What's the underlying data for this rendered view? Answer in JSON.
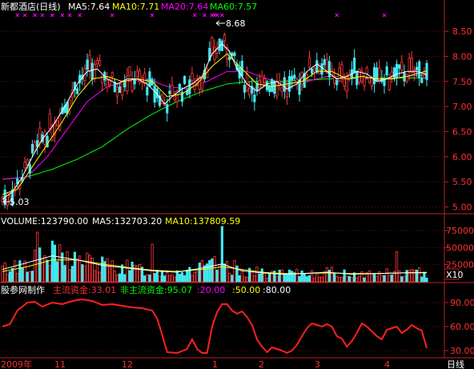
{
  "price_header": {
    "name": "新都酒店(日线)",
    "ma5": "MA5:7.64",
    "ma10": "MA10:7.71",
    "ma20": "MA20:7.64",
    "ma60": "MA60:7.57"
  },
  "price_annotations": {
    "high": "8.68",
    "low": "5.03"
  },
  "volume_header": {
    "volume": "VOLUME:123790.00",
    "ma5": "MA5:132703.20",
    "ma10": "MA10:137809.59"
  },
  "volume_unit": "X10",
  "indicator_header": {
    "title": "股参网制作",
    "main_fund": "主流资金:33.01",
    "non_main_fund": "非主流资金:95.07",
    "l20": ":20.00",
    "l50": ":50.00",
    "l80": ":80.00"
  },
  "x_axis": {
    "labels": [
      "2009年",
      "11",
      "12",
      "1",
      "2",
      "3",
      "4"
    ],
    "corner": "日线"
  },
  "colors": {
    "up": "#ff3b3b",
    "down": "#40e8f0",
    "ma5": "#ffffff",
    "ma10": "#ffff00",
    "ma20": "#ff00ff",
    "ma60": "#00ff00",
    "axis": "#c02020",
    "indicator": "#ff2020"
  },
  "chart_data": [
    {
      "type": "candlestick",
      "title": "新都酒店(日线)",
      "y_ticks": [
        5.0,
        5.5,
        6.0,
        6.5,
        7.0,
        7.5,
        8.0,
        8.5
      ],
      "ylim": [
        4.88,
        8.82
      ],
      "annotations": [
        {
          "label": "8.68",
          "value": 8.68
        },
        {
          "label": "5.03",
          "value": 5.03
        }
      ],
      "series": [
        {
          "name": "MA5",
          "anchors": [
            [
              0,
              5.15
            ],
            [
              4,
              5.3
            ],
            [
              8,
              5.6
            ],
            [
              12,
              6.0
            ],
            [
              16,
              6.35
            ],
            [
              20,
              6.6
            ],
            [
              25,
              7.0
            ],
            [
              30,
              7.45
            ],
            [
              34,
              7.7
            ],
            [
              38,
              7.75
            ],
            [
              42,
              7.55
            ],
            [
              46,
              7.45
            ],
            [
              50,
              7.55
            ],
            [
              54,
              7.55
            ],
            [
              58,
              7.45
            ],
            [
              62,
              7.25
            ],
            [
              65,
              7.05
            ],
            [
              68,
              7.2
            ],
            [
              72,
              7.35
            ],
            [
              76,
              7.45
            ],
            [
              80,
              7.6
            ],
            [
              84,
              8.05
            ],
            [
              88,
              8.25
            ],
            [
              91,
              8.1
            ],
            [
              94,
              7.75
            ],
            [
              98,
              7.45
            ],
            [
              102,
              7.3
            ],
            [
              106,
              7.45
            ],
            [
              110,
              7.5
            ],
            [
              114,
              7.35
            ],
            [
              118,
              7.45
            ],
            [
              122,
              7.7
            ],
            [
              126,
              7.85
            ],
            [
              130,
              7.7
            ],
            [
              134,
              7.55
            ],
            [
              138,
              7.6
            ],
            [
              142,
              7.7
            ],
            [
              146,
              7.65
            ],
            [
              150,
              7.5
            ],
            [
              154,
              7.55
            ],
            [
              158,
              7.65
            ],
            [
              162,
              7.7
            ],
            [
              166,
              7.7
            ],
            [
              170,
              7.64
            ]
          ]
        },
        {
          "name": "MA10",
          "anchors": [
            [
              0,
              5.25
            ],
            [
              6,
              5.35
            ],
            [
              12,
              5.8
            ],
            [
              18,
              6.25
            ],
            [
              24,
              6.7
            ],
            [
              30,
              7.2
            ],
            [
              36,
              7.55
            ],
            [
              42,
              7.6
            ],
            [
              48,
              7.5
            ],
            [
              54,
              7.55
            ],
            [
              60,
              7.5
            ],
            [
              66,
              7.2
            ],
            [
              72,
              7.25
            ],
            [
              78,
              7.45
            ],
            [
              84,
              7.8
            ],
            [
              90,
              8.05
            ],
            [
              96,
              7.75
            ],
            [
              102,
              7.45
            ],
            [
              108,
              7.4
            ],
            [
              114,
              7.45
            ],
            [
              120,
              7.5
            ],
            [
              126,
              7.7
            ],
            [
              132,
              7.7
            ],
            [
              138,
              7.55
            ],
            [
              144,
              7.6
            ],
            [
              150,
              7.55
            ],
            [
              156,
              7.55
            ],
            [
              162,
              7.6
            ],
            [
              170,
              7.71
            ]
          ]
        },
        {
          "name": "MA20",
          "anchors": [
            [
              0,
              5.55
            ],
            [
              10,
              5.6
            ],
            [
              18,
              6.0
            ],
            [
              26,
              6.55
            ],
            [
              34,
              7.1
            ],
            [
              42,
              7.4
            ],
            [
              50,
              7.5
            ],
            [
              58,
              7.55
            ],
            [
              66,
              7.4
            ],
            [
              74,
              7.35
            ],
            [
              82,
              7.5
            ],
            [
              90,
              7.7
            ],
            [
              98,
              7.7
            ],
            [
              106,
              7.55
            ],
            [
              114,
              7.45
            ],
            [
              122,
              7.5
            ],
            [
              130,
              7.6
            ],
            [
              138,
              7.6
            ],
            [
              146,
              7.55
            ],
            [
              154,
              7.55
            ],
            [
              162,
              7.6
            ],
            [
              170,
              7.64
            ]
          ]
        },
        {
          "name": "MA60",
          "anchors": [
            [
              0,
              5.55
            ],
            [
              10,
              5.6
            ],
            [
              20,
              5.75
            ],
            [
              30,
              5.95
            ],
            [
              40,
              6.2
            ],
            [
              50,
              6.55
            ],
            [
              60,
              6.85
            ],
            [
              70,
              7.1
            ],
            [
              80,
              7.3
            ],
            [
              90,
              7.45
            ],
            [
              100,
              7.5
            ],
            [
              110,
              7.5
            ],
            [
              120,
              7.52
            ],
            [
              130,
              7.55
            ],
            [
              140,
              7.56
            ],
            [
              150,
              7.57
            ],
            [
              160,
              7.57
            ],
            [
              170,
              7.57
            ]
          ]
        }
      ]
    },
    {
      "type": "bar",
      "title": "VOLUME",
      "y_ticks": [
        25000,
        50000,
        75000
      ],
      "ylim": [
        0,
        82000
      ],
      "unit": "X10",
      "series": [
        {
          "name": "MA5",
          "anchors": [
            [
              0,
              18000
            ],
            [
              10,
              28000
            ],
            [
              20,
              38000
            ],
            [
              30,
              32000
            ],
            [
              40,
              24000
            ],
            [
              50,
              20000
            ],
            [
              60,
              16000
            ],
            [
              70,
              14000
            ],
            [
              80,
              20000
            ],
            [
              88,
              26000
            ],
            [
              96,
              16000
            ],
            [
              104,
              13000
            ],
            [
              112,
              11000
            ],
            [
              120,
              12000
            ],
            [
              130,
              14000
            ],
            [
              140,
              11000
            ],
            [
              150,
              12000
            ],
            [
              160,
              13000
            ],
            [
              170,
              13270
            ]
          ]
        },
        {
          "name": "MA10",
          "anchors": [
            [
              0,
              15000
            ],
            [
              10,
              22000
            ],
            [
              20,
              32000
            ],
            [
              30,
              32000
            ],
            [
              40,
              26000
            ],
            [
              50,
              21000
            ],
            [
              60,
              17000
            ],
            [
              70,
              15000
            ],
            [
              80,
              18000
            ],
            [
              88,
              22000
            ],
            [
              96,
              18000
            ],
            [
              104,
              14000
            ],
            [
              112,
              12000
            ],
            [
              120,
              12000
            ],
            [
              130,
              13000
            ],
            [
              140,
              12000
            ],
            [
              150,
              12000
            ],
            [
              160,
              13000
            ],
            [
              170,
              13781
            ]
          ]
        }
      ]
    },
    {
      "type": "line",
      "title": "股参网制作",
      "y_ticks": [
        30.0,
        60.0,
        90.0
      ],
      "ylim": [
        22,
        100
      ],
      "reference_lines": [
        20,
        50,
        80
      ],
      "series": [
        {
          "name": "主流资金",
          "anchors": [
            [
              0,
              60
            ],
            [
              3,
              63
            ],
            [
              6,
              80
            ],
            [
              10,
              90
            ],
            [
              13,
              91
            ],
            [
              16,
              85
            ],
            [
              20,
              90
            ],
            [
              24,
              88
            ],
            [
              28,
              92
            ],
            [
              32,
              94
            ],
            [
              36,
              92
            ],
            [
              40,
              87
            ],
            [
              44,
              88
            ],
            [
              48,
              86
            ],
            [
              52,
              84
            ],
            [
              56,
              83
            ],
            [
              60,
              80
            ],
            [
              62,
              70
            ],
            [
              64,
              50
            ],
            [
              66,
              28
            ],
            [
              70,
              27
            ],
            [
              74,
              32
            ],
            [
              76,
              44
            ],
            [
              78,
              32
            ],
            [
              80,
              27
            ],
            [
              82,
              27
            ],
            [
              84,
              60
            ],
            [
              86,
              78
            ],
            [
              88,
              88
            ],
            [
              90,
              88
            ],
            [
              92,
              80
            ],
            [
              94,
              76
            ],
            [
              96,
              79
            ],
            [
              98,
              72
            ],
            [
              100,
              62
            ],
            [
              102,
              44
            ],
            [
              104,
              35
            ],
            [
              106,
              28
            ],
            [
              108,
              34
            ],
            [
              110,
              32
            ],
            [
              112,
              30
            ],
            [
              114,
              27
            ],
            [
              116,
              30
            ],
            [
              118,
              37
            ],
            [
              120,
              48
            ],
            [
              122,
              58
            ],
            [
              124,
              64
            ],
            [
              126,
              62
            ],
            [
              128,
              60
            ],
            [
              130,
              63
            ],
            [
              132,
              60
            ],
            [
              134,
              48
            ],
            [
              136,
              45
            ],
            [
              138,
              35
            ],
            [
              140,
              42
            ],
            [
              142,
              52
            ],
            [
              144,
              64
            ],
            [
              146,
              60
            ],
            [
              148,
              54
            ],
            [
              150,
              48
            ],
            [
              152,
              44
            ],
            [
              154,
              56
            ],
            [
              156,
              58
            ],
            [
              158,
              60
            ],
            [
              160,
              52
            ],
            [
              162,
              56
            ],
            [
              164,
              62
            ],
            [
              166,
              58
            ],
            [
              168,
              55
            ],
            [
              170,
              33
            ]
          ]
        },
        {
          "name": "非主流资金",
          "anchors": [
            [
              0,
              95
            ],
            [
              170,
              95
            ]
          ]
        }
      ]
    }
  ]
}
